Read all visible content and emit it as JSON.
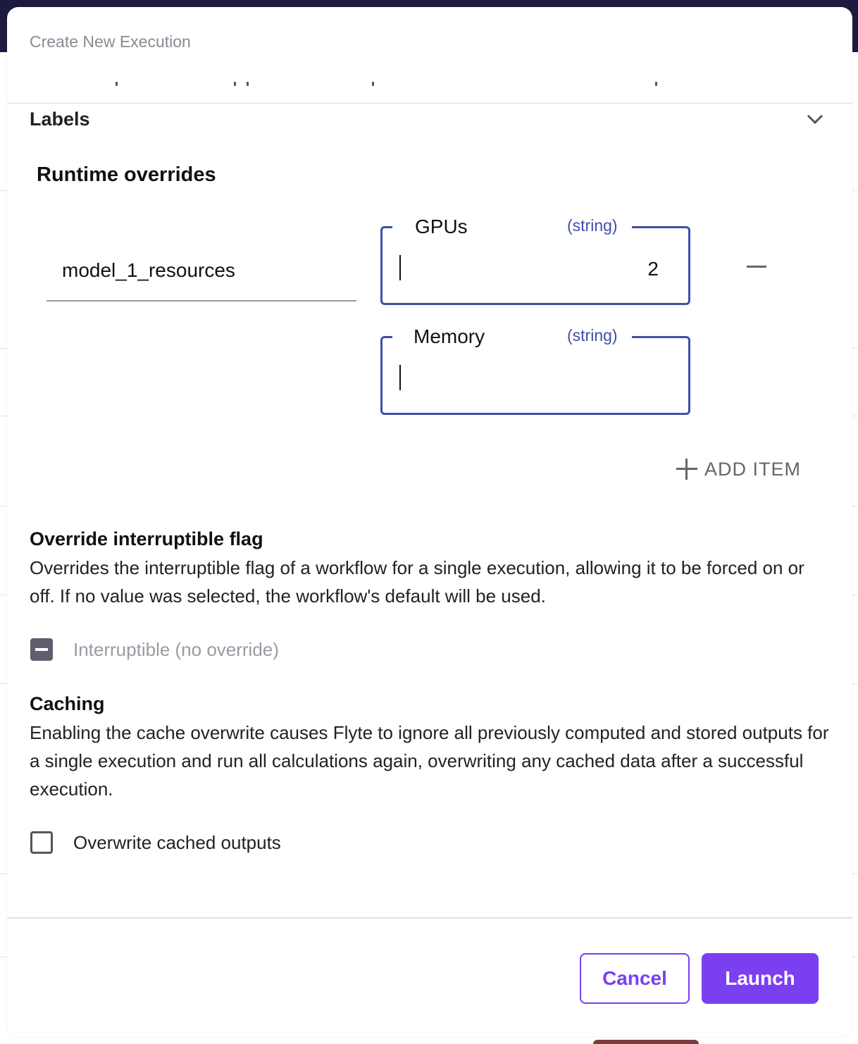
{
  "modal": {
    "title": "Create New Execution"
  },
  "labels_section": {
    "title": "Labels"
  },
  "runtime_overrides": {
    "title": "Runtime overrides",
    "key": "model_1_resources",
    "fields": [
      {
        "label": "GPUs",
        "type": "(string)",
        "value": "2"
      },
      {
        "label": "Memory",
        "type": "(string)",
        "value": ""
      }
    ],
    "add_item_label": "ADD ITEM"
  },
  "interruptible": {
    "title": "Override interruptible flag",
    "description": "Overrides the interruptible flag of a workflow for a single execution, allowing it to be forced on or off. If no value was selected, the workflow's default will be used.",
    "checkbox_label": "Interruptible (no override)",
    "checkbox_state": "indeterminate"
  },
  "caching": {
    "title": "Caching",
    "description": "Enabling the cache overwrite causes Flyte to ignore all previously computed and stored outputs for a single execution and run all calculations again, overwriting any cached data after a successful execution.",
    "checkbox_label": "Overwrite cached outputs",
    "checkbox_state": "unchecked"
  },
  "footer": {
    "cancel_label": "Cancel",
    "launch_label": "Launch"
  },
  "colors": {
    "accent": "#7b3ff2",
    "field_border": "#3f4fa8",
    "topbar": "#1d1a3f"
  },
  "icons": {
    "labels_toggle": "chevron-down-icon",
    "remove": "minus-icon",
    "add": "plus-icon"
  }
}
